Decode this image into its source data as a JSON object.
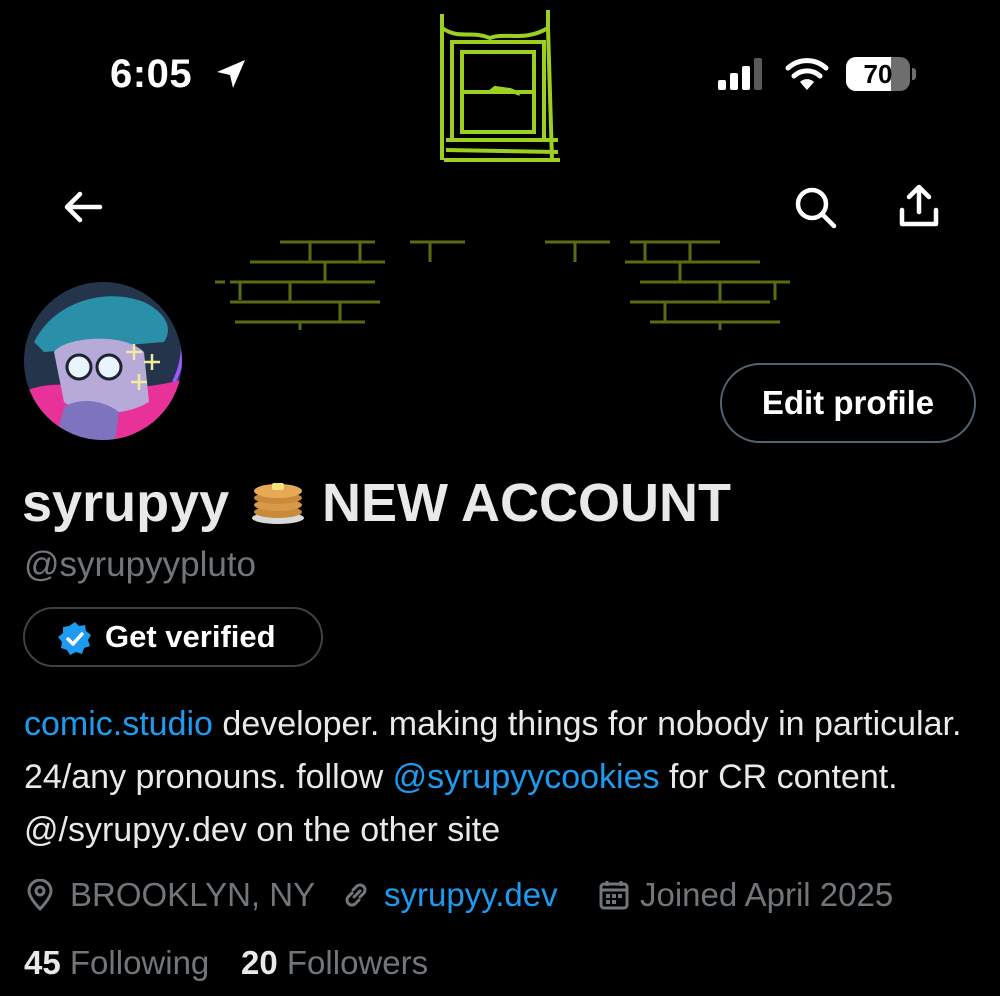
{
  "status_bar": {
    "time": "6:05",
    "battery": "70",
    "battery_level": 0.7
  },
  "icons": {
    "back": "arrow-left-icon",
    "search": "search-icon",
    "share": "share-icon",
    "location_services": "location-arrow-icon",
    "verified": "verified-badge-icon",
    "location": "map-pin-icon",
    "link": "link-icon",
    "calendar": "calendar-icon"
  },
  "colors": {
    "link": "#1d9bf0",
    "muted": "#71767b",
    "banner_art": "#9ccf1f"
  },
  "profile": {
    "name_part1": "syrupyy",
    "name_part2": "NEW ACCOUNT",
    "handle": "@syrupyypluto",
    "edit_label": "Edit profile",
    "verify_label": "Get verified",
    "bio": {
      "link1": "comic.studio",
      "text1": " developer. making things for nobody in particular. 24/any pronouns. follow ",
      "mention": "@syrupyycookies",
      "text2": " for CR content. @/syrupyy.dev on the other site"
    },
    "location": "BROOKLYN, NY",
    "website": "syrupyy.dev",
    "joined": "Joined April 2025",
    "following_count": "45",
    "following_label": "Following",
    "followers_count": "20",
    "followers_label": "Followers"
  }
}
